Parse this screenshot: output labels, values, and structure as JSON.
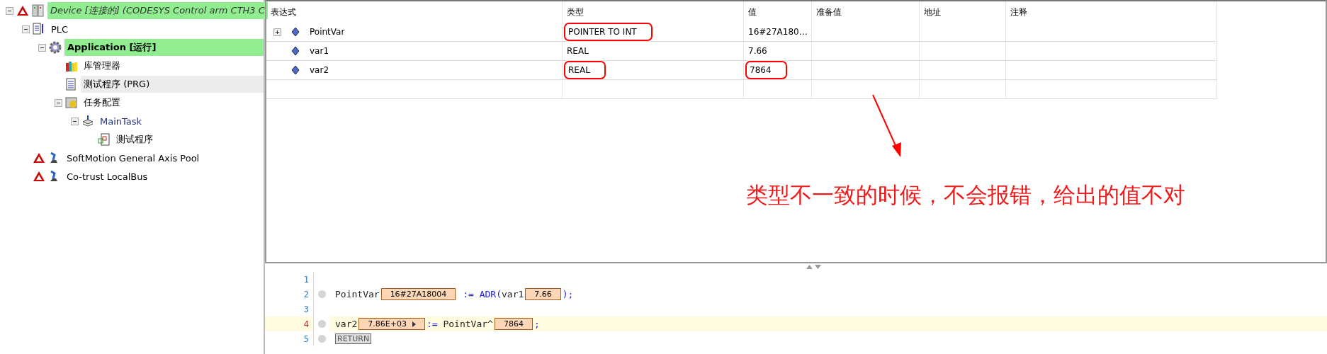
{
  "tree": [
    {
      "label": "Device [连接的] (CODESYS Control arm CTH3 C",
      "kind": "device",
      "warning": true,
      "highlighted": true,
      "selected": false,
      "expanded": true,
      "children": [
        {
          "label": "PLC",
          "kind": "plc",
          "warning": false,
          "highlighted": false,
          "selected": false,
          "expanded": true,
          "children": [
            {
              "label": "Application [运行]",
              "kind": "application",
              "warning": false,
              "highlighted": true,
              "selected": false,
              "expanded": true,
              "children": [
                {
                  "label": "库管理器",
                  "kind": "library",
                  "warning": false,
                  "highlighted": false,
                  "selected": false
                },
                {
                  "label": "测试程序 (PRG)",
                  "kind": "program",
                  "warning": false,
                  "highlighted": false,
                  "selected": true
                },
                {
                  "label": "任务配置",
                  "kind": "task-config",
                  "warning": false,
                  "highlighted": false,
                  "selected": false,
                  "expanded": true,
                  "children": [
                    {
                      "label": "MainTask",
                      "kind": "task",
                      "warning": false,
                      "highlighted": false,
                      "selected": false,
                      "expanded": true,
                      "children": [
                        {
                          "label": "测试程序",
                          "kind": "program-call",
                          "warning": false,
                          "highlighted": false,
                          "selected": false
                        }
                      ]
                    }
                  ]
                }
              ]
            }
          ]
        },
        {
          "label": "SoftMotion General Axis Pool",
          "kind": "axis",
          "warning": true,
          "highlighted": false,
          "selected": false
        },
        {
          "label": "Co-trust LocalBus",
          "kind": "axis",
          "warning": true,
          "highlighted": false,
          "selected": false
        }
      ]
    }
  ],
  "watch_table": {
    "columns": [
      "表达式",
      "类型",
      "值",
      "准备值",
      "地址",
      "注释"
    ],
    "rows": [
      {
        "expression": "PointVar",
        "expanded": false,
        "type": "POINTER TO INT",
        "type_marked": true,
        "value": "16#27A180…",
        "value_marked": false
      },
      {
        "expression": "var1",
        "type": "REAL",
        "type_marked": false,
        "value": "7.66",
        "value_marked": false
      },
      {
        "expression": "var2",
        "type": "REAL",
        "type_marked": true,
        "value": "7864",
        "value_marked": true
      }
    ]
  },
  "annotation": "类型不一致的时候，不会报错，给出的值不对",
  "code": [
    {
      "number": "1",
      "breakpoint": false,
      "current": false
    },
    {
      "number": "2",
      "breakpoint": true,
      "current": false,
      "segments": [
        {
          "kind": "code",
          "text": "PointVar"
        },
        {
          "kind": "value",
          "text": "16#27A18004"
        },
        {
          "kind": "op",
          "text": " := "
        },
        {
          "kind": "keyword",
          "text": "ADR"
        },
        {
          "kind": "op",
          "text": "("
        },
        {
          "kind": "code",
          "text": "var1"
        },
        {
          "kind": "value",
          "text": "7.66"
        },
        {
          "kind": "op",
          "text": ");"
        }
      ]
    },
    {
      "number": "3",
      "breakpoint": false,
      "current": false
    },
    {
      "number": "4",
      "breakpoint": true,
      "current": true,
      "segments": [
        {
          "kind": "code",
          "text": "var2"
        },
        {
          "kind": "value",
          "text": "7.86E+03",
          "expandable": true
        },
        {
          "kind": "op",
          "text": ":= "
        },
        {
          "kind": "code",
          "text": "PointVar^"
        },
        {
          "kind": "value",
          "text": "7864"
        },
        {
          "kind": "op",
          "text": ";"
        }
      ]
    },
    {
      "number": "5",
      "breakpoint": true,
      "current": false,
      "segments": [
        {
          "kind": "return",
          "text": "RETURN"
        }
      ]
    }
  ]
}
